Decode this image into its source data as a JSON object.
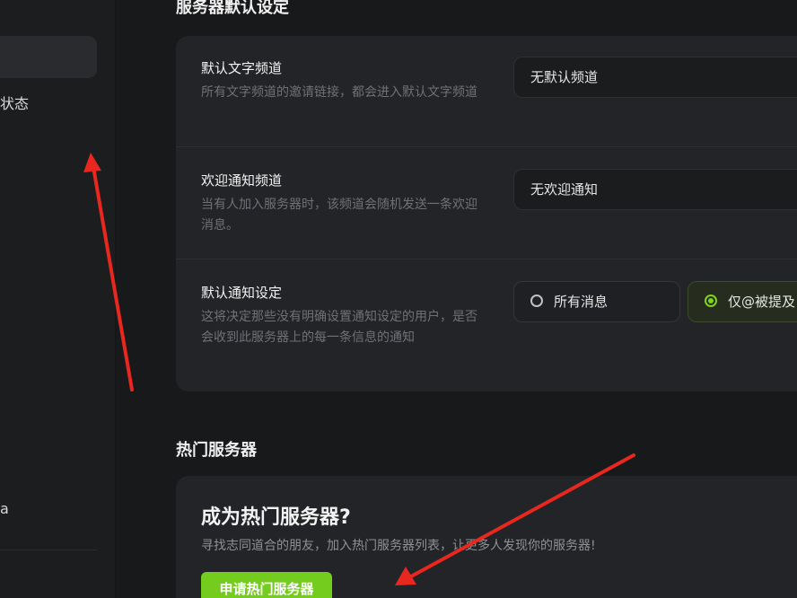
{
  "sidebar": {
    "partial_label_1": "状态",
    "partial_label_2": "a"
  },
  "section_defaults": {
    "title": "服务器默认设定",
    "rows": [
      {
        "title": "默认文字频道",
        "desc": "所有文字频道的邀请链接，都会进入默认文字频道",
        "value": "无默认频道"
      },
      {
        "title": "欢迎通知频道",
        "desc": "当有人加入服务器时，该频道会随机发送一条欢迎消息。",
        "value": "无欢迎通知"
      },
      {
        "title": "默认通知设定",
        "desc": "这将决定那些没有明确设置通知设定的用户，是否会收到此服务器上的每一条信息的通知",
        "options": [
          {
            "label": "所有消息",
            "selected": false
          },
          {
            "label": "仅@被提及",
            "selected": true
          }
        ]
      }
    ]
  },
  "section_hot": {
    "title": "热门服务器",
    "card_title": "成为热门服务器?",
    "card_desc": "寻找志同道合的朋友，加入热门服务器列表，让更多人发现你的服务器!",
    "button_label": "申请热门服务器"
  },
  "colors": {
    "accent_green": "#74cc1f",
    "annotation_red": "#e8271f"
  }
}
